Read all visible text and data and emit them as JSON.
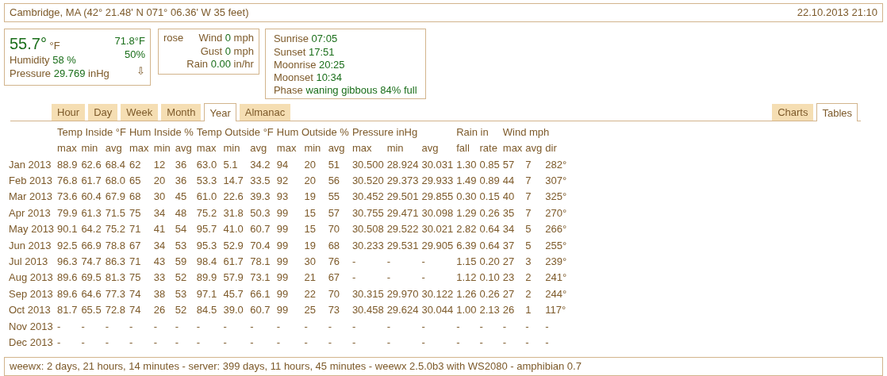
{
  "header": {
    "location": "Cambridge, MA (42° 21.48' N 071° 06.36' W 35 feet)",
    "datetime": "22.10.2013 21:10"
  },
  "current": {
    "temperature": "55.7°",
    "temp_unit": "°F",
    "inside_temp": "71.8°F",
    "humidity_label": "Humidity",
    "humidity": "58 %",
    "inside_humidity": "50%",
    "pressure_label": "Pressure",
    "pressure": "29.769",
    "pressure_unit": "inHg",
    "trend": "⇩"
  },
  "wind": {
    "rose": "rose",
    "rows": [
      {
        "label": "Wind",
        "value": "0",
        "unit": "mph"
      },
      {
        "label": "Gust",
        "value": "0",
        "unit": "mph"
      },
      {
        "label": "Rain",
        "value": "0.00",
        "unit": "in/hr"
      }
    ]
  },
  "almanac": [
    {
      "label": "Sunrise",
      "value": "07:05"
    },
    {
      "label": "Sunset",
      "value": "17:51"
    },
    {
      "label": "Moonrise",
      "value": "20:25"
    },
    {
      "label": "Moonset",
      "value": "10:34"
    },
    {
      "label": "Phase",
      "value": "waning gibbous 84% full"
    }
  ],
  "period_tabs": [
    {
      "label": "Hour",
      "selected": false
    },
    {
      "label": "Day",
      "selected": false
    },
    {
      "label": "Week",
      "selected": false
    },
    {
      "label": "Month",
      "selected": false
    },
    {
      "label": "Year",
      "selected": true
    },
    {
      "label": "Almanac",
      "selected": false
    }
  ],
  "view_tabs": [
    {
      "label": "Charts",
      "selected": false
    },
    {
      "label": "Tables",
      "selected": true
    }
  ],
  "table": {
    "groups": [
      {
        "label": "Temp Inside °F",
        "columns": [
          "max",
          "min",
          "avg"
        ]
      },
      {
        "label": "Hum Inside %",
        "columns": [
          "max",
          "min",
          "avg"
        ]
      },
      {
        "label": "Temp Outside °F",
        "columns": [
          "max",
          "min",
          "avg"
        ]
      },
      {
        "label": "Hum Outside %",
        "columns": [
          "max",
          "min",
          "avg"
        ]
      },
      {
        "label": "Pressure inHg",
        "columns": [
          "max",
          "min",
          "avg"
        ]
      },
      {
        "label": "Rain in",
        "columns": [
          "fall",
          "rate"
        ]
      },
      {
        "label": "Wind mph",
        "columns": [
          "max",
          "avg",
          "dir"
        ]
      }
    ],
    "rows": [
      {
        "label": "Jan 2013",
        "cells": [
          "88.9",
          "62.6",
          "68.4",
          "62",
          "12",
          "36",
          "63.0",
          "5.1",
          "34.2",
          "94",
          "20",
          "51",
          "30.500",
          "28.924",
          "30.031",
          "1.30",
          "0.85",
          "57",
          "7",
          "282°"
        ]
      },
      {
        "label": "Feb 2013",
        "cells": [
          "76.8",
          "61.7",
          "68.0",
          "65",
          "20",
          "36",
          "53.3",
          "14.7",
          "33.5",
          "92",
          "20",
          "56",
          "30.520",
          "29.373",
          "29.933",
          "1.49",
          "0.89",
          "44",
          "7",
          "307°"
        ]
      },
      {
        "label": "Mar 2013",
        "cells": [
          "73.6",
          "60.4",
          "67.9",
          "68",
          "30",
          "45",
          "61.0",
          "22.6",
          "39.3",
          "93",
          "19",
          "55",
          "30.452",
          "29.501",
          "29.855",
          "0.30",
          "0.15",
          "40",
          "7",
          "325°"
        ]
      },
      {
        "label": "Apr 2013",
        "cells": [
          "79.9",
          "61.3",
          "71.5",
          "75",
          "34",
          "48",
          "75.2",
          "31.8",
          "50.3",
          "99",
          "15",
          "57",
          "30.755",
          "29.471",
          "30.098",
          "1.29",
          "0.26",
          "35",
          "7",
          "270°"
        ]
      },
      {
        "label": "May 2013",
        "cells": [
          "90.1",
          "64.2",
          "75.2",
          "71",
          "41",
          "54",
          "95.7",
          "41.0",
          "60.7",
          "99",
          "15",
          "70",
          "30.508",
          "29.522",
          "30.021",
          "2.82",
          "0.64",
          "34",
          "5",
          "266°"
        ]
      },
      {
        "label": "Jun 2013",
        "cells": [
          "92.5",
          "66.9",
          "78.8",
          "67",
          "34",
          "53",
          "95.3",
          "52.9",
          "70.4",
          "99",
          "19",
          "68",
          "30.233",
          "29.531",
          "29.905",
          "6.39",
          "0.64",
          "37",
          "5",
          "255°"
        ]
      },
      {
        "label": "Jul 2013",
        "cells": [
          "96.3",
          "74.7",
          "86.3",
          "71",
          "43",
          "59",
          "98.4",
          "61.7",
          "78.1",
          "99",
          "30",
          "76",
          "-",
          "-",
          "-",
          "1.15",
          "0.20",
          "27",
          "3",
          "239°"
        ]
      },
      {
        "label": "Aug 2013",
        "cells": [
          "89.6",
          "69.5",
          "81.3",
          "75",
          "33",
          "52",
          "89.9",
          "57.9",
          "73.1",
          "99",
          "21",
          "67",
          "-",
          "-",
          "-",
          "1.12",
          "0.10",
          "23",
          "2",
          "241°"
        ]
      },
      {
        "label": "Sep 2013",
        "cells": [
          "89.6",
          "64.6",
          "77.3",
          "74",
          "38",
          "53",
          "97.1",
          "45.7",
          "66.1",
          "99",
          "22",
          "70",
          "30.315",
          "29.970",
          "30.122",
          "1.26",
          "0.26",
          "27",
          "2",
          "244°"
        ]
      },
      {
        "label": "Oct 2013",
        "cells": [
          "81.7",
          "65.5",
          "72.8",
          "74",
          "26",
          "52",
          "84.5",
          "39.0",
          "60.7",
          "99",
          "25",
          "73",
          "30.458",
          "29.624",
          "30.044",
          "1.00",
          "2.13",
          "26",
          "1",
          "117°"
        ]
      },
      {
        "label": "Nov 2013",
        "cells": [
          "-",
          "-",
          "-",
          "-",
          "-",
          "-",
          "-",
          "-",
          "-",
          "-",
          "-",
          "-",
          "-",
          "-",
          "-",
          "-",
          "-",
          "-",
          "-",
          "-"
        ]
      },
      {
        "label": "Dec 2013",
        "cells": [
          "-",
          "-",
          "-",
          "-",
          "-",
          "-",
          "-",
          "-",
          "-",
          "-",
          "-",
          "-",
          "-",
          "-",
          "-",
          "-",
          "-",
          "-",
          "-",
          "-"
        ]
      }
    ]
  },
  "footer": "weewx: 2 days, 21 hours, 14 minutes - server: 399 days, 11 hours, 45 minutes - weewx 2.5.0b3 with WS2080 - amphibian 0.7"
}
